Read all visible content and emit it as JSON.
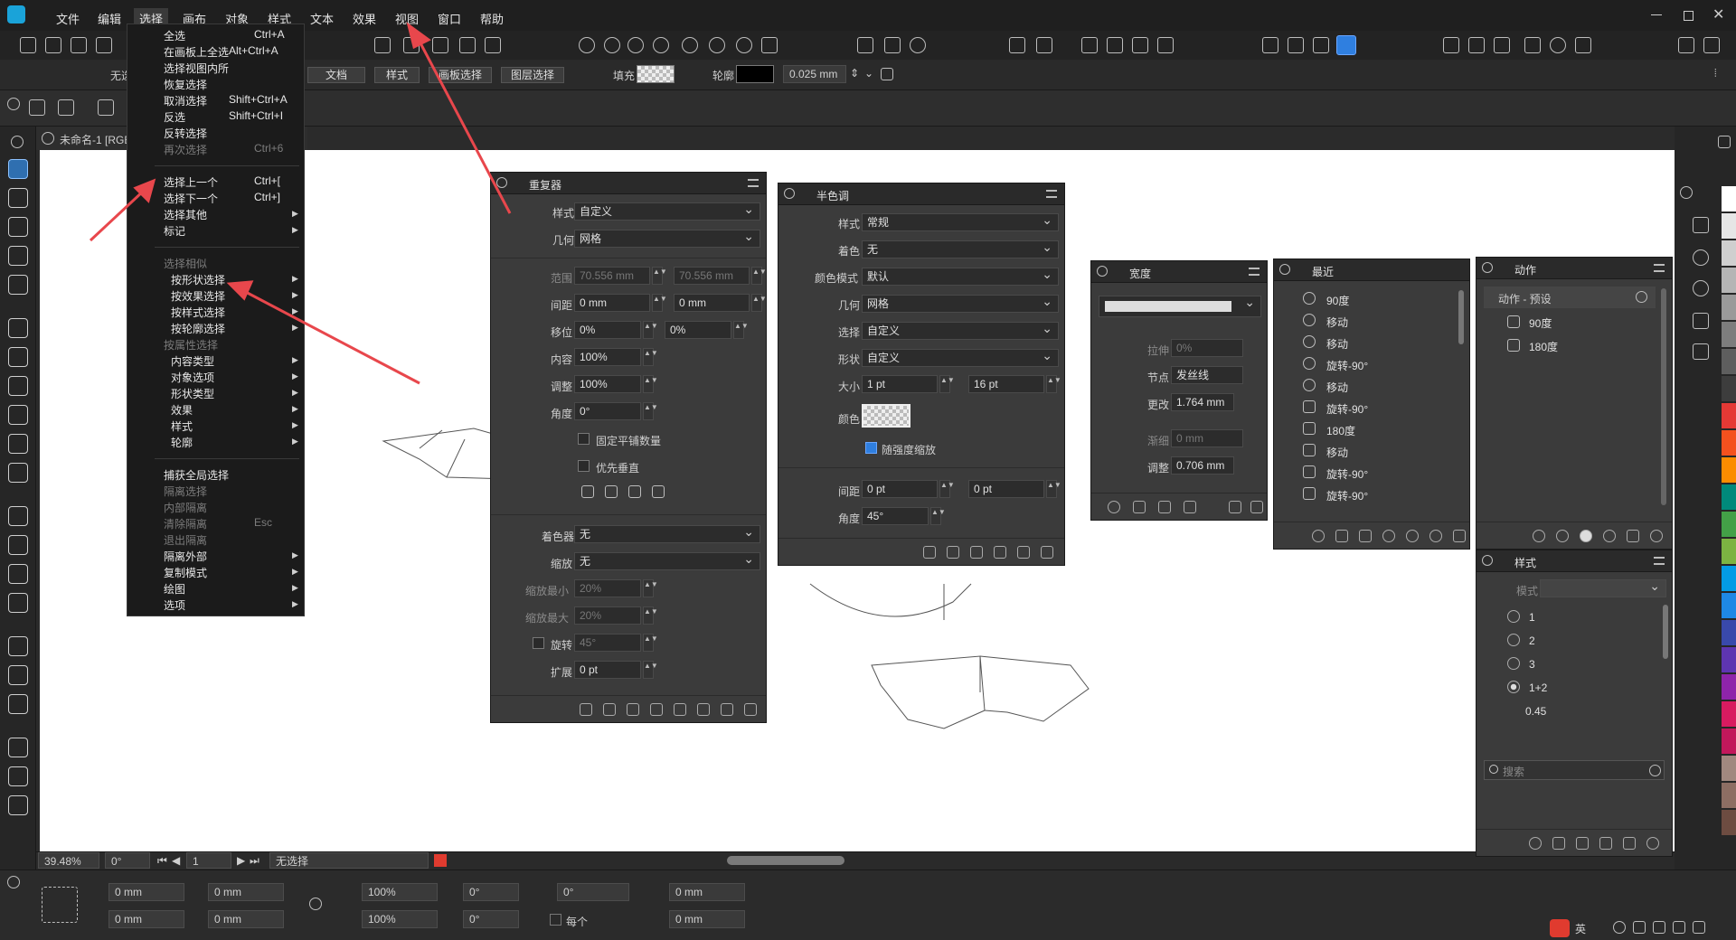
{
  "menubar": {
    "items": [
      "文件",
      "编辑",
      "选择",
      "画布",
      "对象",
      "样式",
      "文本",
      "效果",
      "视图",
      "窗口",
      "帮助"
    ],
    "active": "选择"
  },
  "toolbar2": {
    "left_label": "无选",
    "buttons": [
      "文档",
      "样式",
      "画板选择",
      "图层选择"
    ],
    "fill_label": "填充",
    "stroke_label": "轮廓",
    "stroke_width": "0.025 mm"
  },
  "document": {
    "tab": "未命名-1 [RGB"
  },
  "select_menu": {
    "items": [
      {
        "label": "全选",
        "shortcut": "Ctrl+A",
        "disabled": false
      },
      {
        "label": "在画板上全选",
        "shortcut": "Alt+Ctrl+A",
        "disabled": false
      },
      {
        "label": "选择视图内所",
        "shortcut": "",
        "disabled": false
      },
      {
        "label": "恢复选择",
        "shortcut": "",
        "disabled": false
      },
      {
        "label": "取消选择",
        "shortcut": "Shift+Ctrl+A",
        "disabled": false
      },
      {
        "label": "反选",
        "shortcut": "Shift+Ctrl+I",
        "disabled": false
      },
      {
        "label": "反转选择",
        "shortcut": "",
        "disabled": false
      },
      {
        "label": "再次选择",
        "shortcut": "Ctrl+6",
        "disabled": true
      },
      {
        "label": "选择上一个",
        "shortcut": "Ctrl+[",
        "disabled": false
      },
      {
        "label": "选择下一个",
        "shortcut": "Ctrl+]",
        "disabled": false
      },
      {
        "label": "选择其他",
        "shortcut": "",
        "disabled": false,
        "submenu": true
      },
      {
        "label": "标记",
        "shortcut": "",
        "disabled": false,
        "submenu": true
      },
      {
        "label": "选择相似",
        "shortcut": "",
        "disabled": true
      },
      {
        "label": "按形状选择",
        "shortcut": "",
        "disabled": false,
        "submenu": true,
        "indent": true
      },
      {
        "label": "按效果选择",
        "shortcut": "",
        "disabled": false,
        "submenu": true,
        "indent": true
      },
      {
        "label": "按样式选择",
        "shortcut": "",
        "disabled": false,
        "submenu": true,
        "indent": true
      },
      {
        "label": "按轮廓选择",
        "shortcut": "",
        "disabled": false,
        "submenu": true,
        "indent": true
      },
      {
        "label": "按属性选择",
        "shortcut": "",
        "disabled": true
      },
      {
        "label": "内容类型",
        "shortcut": "",
        "disabled": false,
        "submenu": true,
        "indent": true
      },
      {
        "label": "对象选项",
        "shortcut": "",
        "disabled": false,
        "submenu": true,
        "indent": true
      },
      {
        "label": "形状类型",
        "shortcut": "",
        "disabled": false,
        "submenu": true,
        "indent": true
      },
      {
        "label": "效果",
        "shortcut": "",
        "disabled": false,
        "submenu": true,
        "indent": true
      },
      {
        "label": "样式",
        "shortcut": "",
        "disabled": false,
        "submenu": true,
        "indent": true
      },
      {
        "label": "轮廓",
        "shortcut": "",
        "disabled": false,
        "submenu": true,
        "indent": true
      },
      {
        "label": "捕获全局选择",
        "shortcut": "",
        "disabled": false
      },
      {
        "label": "隔离选择",
        "shortcut": "",
        "disabled": true
      },
      {
        "label": "内部隔离",
        "shortcut": "",
        "disabled": true
      },
      {
        "label": "清除隔离",
        "shortcut": "Esc",
        "disabled": true
      },
      {
        "label": "退出隔离",
        "shortcut": "",
        "disabled": true
      },
      {
        "label": "隔离外部",
        "shortcut": "",
        "disabled": false,
        "submenu": true
      },
      {
        "label": "复制模式",
        "shortcut": "",
        "disabled": false,
        "submenu": true
      },
      {
        "label": "绘图",
        "shortcut": "",
        "disabled": false,
        "submenu": true
      },
      {
        "label": "选项",
        "shortcut": "",
        "disabled": false,
        "submenu": true
      }
    ]
  },
  "repeater_panel": {
    "title": "重复器",
    "style_label": "样式",
    "style_value": "自定义",
    "geometry_label": "几何",
    "geometry_value": "网格",
    "range_label": "范围",
    "range_a": "70.556 mm",
    "range_b": "70.556 mm",
    "spacing_label": "间距",
    "spacing_a": "0 mm",
    "spacing_b": "0 mm",
    "offset_label": "移位",
    "offset_a": "0%",
    "offset_b": "0%",
    "content_label": "内容",
    "content_value": "100%",
    "adjust_label": "调整",
    "adjust_value": "100%",
    "angle_label": "角度",
    "angle_value": "0°",
    "fixed_tile_label": "固定平铺数量",
    "vertical_first_label": "优先垂直",
    "tint_label": "着色器",
    "tint_value": "无",
    "scale_label": "缩放",
    "scale_value": "无",
    "scale_min_label": "缩放最小",
    "scale_min_value": "20%",
    "scale_max_label": "缩放最大",
    "scale_max_value": "20%",
    "rotate_label": "旋转",
    "rotate_value": "45°",
    "expand_label": "扩展",
    "expand_value": "0 pt"
  },
  "halftone_panel": {
    "title": "半色调",
    "style_label": "样式",
    "style_value": "常规",
    "tint_label": "着色",
    "tint_value": "无",
    "color_mode_label": "颜色模式",
    "color_mode_value": "默认",
    "geometry_label": "几何",
    "geometry_value": "网格",
    "select_label": "选择",
    "select_value": "自定义",
    "shape_label": "形状",
    "shape_value": "自定义",
    "size_label": "大小",
    "size_a": "1 pt",
    "size_b": "16 pt",
    "color_label": "颜色",
    "scale_intensity_label": "随强度缩放",
    "spacing_label": "间距",
    "spacing_a": "0 pt",
    "spacing_b": "0 pt",
    "angle_label": "角度",
    "angle_value": "45°"
  },
  "width_panel": {
    "title": "宽度",
    "stretch_label": "拉伸",
    "stretch_value": "0%",
    "node_label": "节点",
    "node_value": "发丝线",
    "change_label": "更改",
    "change_value": "1.764 mm",
    "taper_label": "渐细",
    "taper_value": "0 mm",
    "adjust_label": "调整",
    "adjust_value": "0.706 mm"
  },
  "recent_panel": {
    "title": "最近",
    "items": [
      {
        "icon": "move-icon",
        "label": "90度"
      },
      {
        "icon": "move-icon",
        "label": "移动"
      },
      {
        "icon": "move-icon",
        "label": "移动"
      },
      {
        "icon": "move-icon",
        "label": "旋转-90°"
      },
      {
        "icon": "move-icon",
        "label": "移动"
      },
      {
        "icon": "trash-icon",
        "label": "旋转-90°"
      },
      {
        "icon": "trash-icon",
        "label": "180度"
      },
      {
        "icon": "transform-icon",
        "label": "移动"
      },
      {
        "icon": "transform-icon",
        "label": "旋转-90°"
      },
      {
        "icon": "transform-icon",
        "label": "旋转-90°"
      }
    ]
  },
  "actions_panel": {
    "title": "动作",
    "group": "动作 - 预设",
    "items": [
      "90度",
      "180度"
    ]
  },
  "styles_panel": {
    "title": "样式",
    "mode_label": "模式",
    "items": [
      "1",
      "2",
      "3",
      "1+2",
      "0.45"
    ],
    "search_placeholder": "搜索"
  },
  "statusbar": {
    "zoom": "39.48%",
    "rotation": "0°",
    "page": "1",
    "selection": "无选择"
  },
  "bottombar": {
    "x1": "0 mm",
    "y1": "0 mm",
    "w1": "0 mm",
    "h1": "0 mm",
    "scale_x": "100%",
    "scale_y": "100%",
    "angle_a": "0°",
    "angle_b": "0°",
    "skew": "0°",
    "dist_a": "0 mm",
    "dist_b": "0 mm",
    "each_label": "每个"
  },
  "taskbar": {
    "ime": "英"
  },
  "colors": {
    "accent": "#2f7fe0",
    "arrow_annotation": "#e8474c",
    "palette": [
      "#ffffff",
      "#e6e6e6",
      "#cfcfcf",
      "#b5b5b5",
      "#9a9a9a",
      "#7d7d7d",
      "#5e5e5e",
      "#3d3d3d",
      "#e53935",
      "#f4511e",
      "#fb8c00",
      "#00897b",
      "#43a047",
      "#7cb342",
      "#039be5",
      "#1e88e5",
      "#3949ab",
      "#5e35b1",
      "#8e24aa",
      "#d81b60",
      "#c2185b",
      "#a1887f",
      "#8d6e63",
      "#6d4c41"
    ]
  }
}
